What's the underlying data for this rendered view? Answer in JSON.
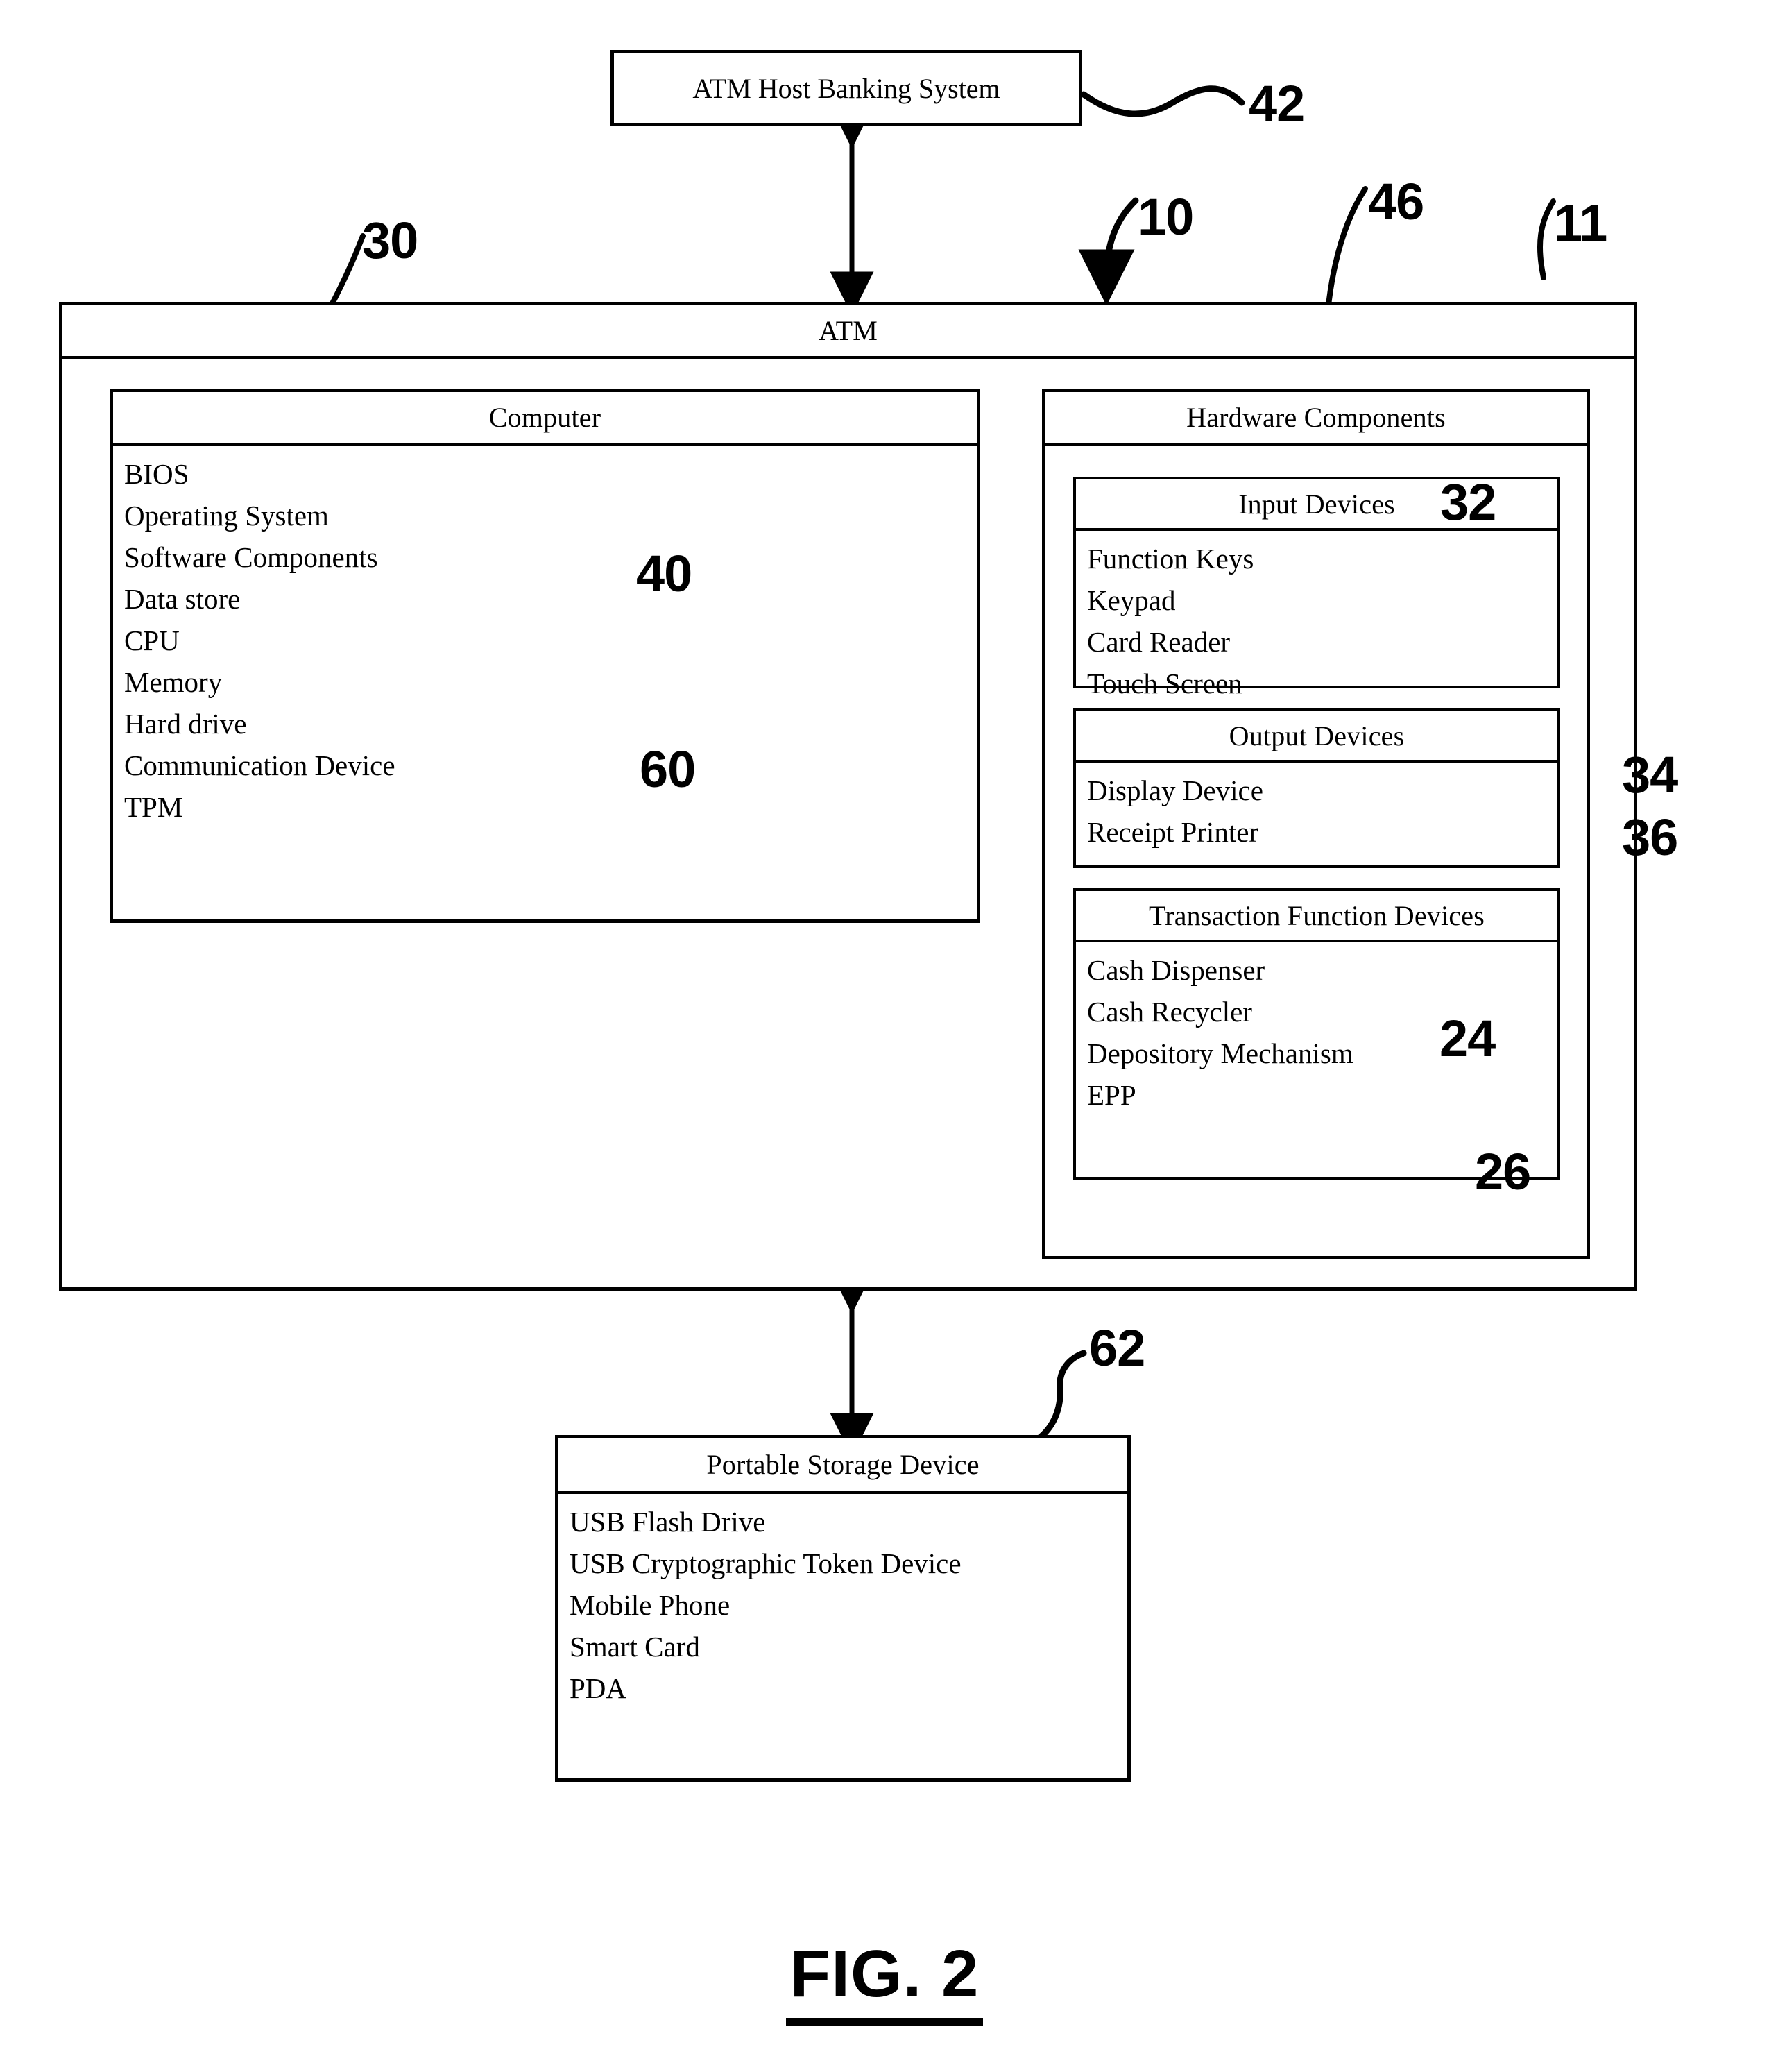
{
  "figure": {
    "caption": "FIG. 2"
  },
  "host": {
    "title": "ATM Host Banking System",
    "ref": "42"
  },
  "atm": {
    "title": "ATM",
    "ref_pointer": "10",
    "ref_outer": "11"
  },
  "computer": {
    "title": "Computer",
    "ref": "30",
    "items": [
      "BIOS",
      "Operating System",
      "Software Components",
      "Data store",
      "CPU",
      "Memory",
      "Hard drive",
      "Communication Device",
      "TPM"
    ],
    "ref_software_components": "40",
    "ref_communication_device": "60"
  },
  "hardware": {
    "title": "Hardware Components",
    "ref": "46",
    "groups": [
      {
        "title": "Input Devices",
        "ref": "32",
        "items": [
          "Function Keys",
          "Keypad",
          "Card Reader",
          "Touch Screen"
        ]
      },
      {
        "title": "Output Devices",
        "ref": "34",
        "items": [
          "Display Device",
          "Receipt Printer"
        ]
      },
      {
        "title": "Transaction Function Devices",
        "ref": "36",
        "items": [
          "Cash Dispenser",
          "Cash Recycler",
          "Depository Mechanism",
          "EPP"
        ],
        "ref_cash_dispenser": "24",
        "ref_epp": "26"
      }
    ]
  },
  "portable": {
    "title": "Portable Storage Device",
    "ref": "62",
    "items": [
      "USB Flash Drive",
      "USB Cryptographic Token Device",
      "Mobile Phone",
      "Smart Card",
      "PDA"
    ]
  },
  "colors": {
    "ink": "#000000",
    "paper": "#ffffff"
  }
}
